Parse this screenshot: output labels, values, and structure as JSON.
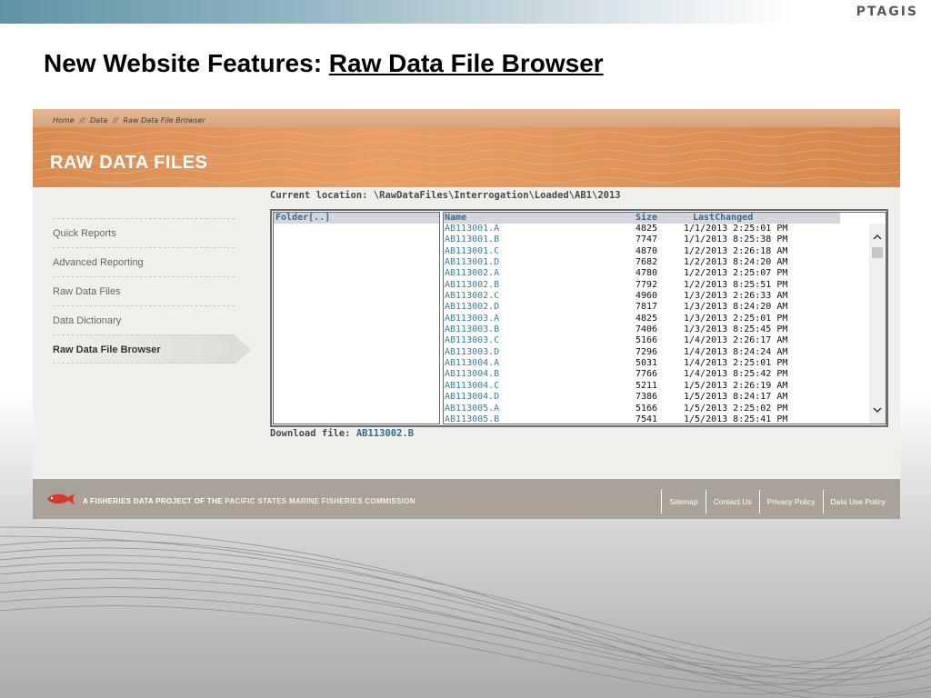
{
  "slide": {
    "logo": "PTAGIS",
    "title_prefix": "New Website Features: ",
    "title_link": "Raw Data File Browser"
  },
  "breadcrumb": [
    "Home",
    "Data",
    "Raw Data File Browser"
  ],
  "breadcrumb_separator": "//",
  "banner": {
    "title": "RAW DATA FILES"
  },
  "nav": [
    {
      "label": "Quick Reports"
    },
    {
      "label": "Advanced Reporting"
    },
    {
      "label": "Raw Data Files"
    },
    {
      "label": "Data Dictionary"
    },
    {
      "label": "Raw Data File Browser",
      "active": true
    }
  ],
  "browser": {
    "location_label": "Current location:",
    "location_path": "\\RawDataFiles\\Interrogation\\Loaded\\AB1\\2013",
    "folder_header": "Folder[..]",
    "columns": {
      "name": "Name",
      "size": "Size",
      "changed": "LastChanged"
    },
    "files": [
      {
        "name": "AB113001.A",
        "size": "4825",
        "changed": "1/1/2013 2:25:01 PM"
      },
      {
        "name": "AB113001.B",
        "size": "7747",
        "changed": "1/1/2013 8:25:38 PM"
      },
      {
        "name": "AB113001.C",
        "size": "4870",
        "changed": "1/2/2013 2:26:18 AM"
      },
      {
        "name": "AB113001.D",
        "size": "7682",
        "changed": "1/2/2013 8:24:20 AM"
      },
      {
        "name": "AB113002.A",
        "size": "4780",
        "changed": "1/2/2013 2:25:07 PM"
      },
      {
        "name": "AB113002.B",
        "size": "7792",
        "changed": "1/2/2013 8:25:51 PM"
      },
      {
        "name": "AB113002.C",
        "size": "4960",
        "changed": "1/3/2013 2:26:33 AM"
      },
      {
        "name": "AB113002.D",
        "size": "7817",
        "changed": "1/3/2013 8:24:20 AM"
      },
      {
        "name": "AB113003.A",
        "size": "4825",
        "changed": "1/3/2013 2:25:01 PM"
      },
      {
        "name": "AB113003.B",
        "size": "7406",
        "changed": "1/3/2013 8:25:45 PM"
      },
      {
        "name": "AB113003.C",
        "size": "5166",
        "changed": "1/4/2013 2:26:17 AM"
      },
      {
        "name": "AB113003.D",
        "size": "7296",
        "changed": "1/4/2013 8:24:24 AM"
      },
      {
        "name": "AB113004.A",
        "size": "5031",
        "changed": "1/4/2013 2:25:01 PM"
      },
      {
        "name": "AB113004.B",
        "size": "7766",
        "changed": "1/4/2013 8:25:42 PM"
      },
      {
        "name": "AB113004.C",
        "size": "5211",
        "changed": "1/5/2013 2:26:19 AM"
      },
      {
        "name": "AB113004.D",
        "size": "7386",
        "changed": "1/5/2013 8:24:17 AM"
      },
      {
        "name": "AB113005.A",
        "size": "5166",
        "changed": "1/5/2013 2:25:02 PM"
      },
      {
        "name": "AB113005.B",
        "size": "7541",
        "changed": "1/5/2013 8:25:41 PM"
      }
    ],
    "download_label": "Download file:",
    "download_file": "AB113002.B"
  },
  "footer": {
    "project_text": "A FISHERIES DATA PROJECT OF THE",
    "org_text": "PACIFIC STATES MARINE FISHERIES COMMISSION",
    "links": [
      "Sitemap",
      "Contact Us",
      "Privacy Policy",
      "Data Use Policy"
    ]
  },
  "icons": {
    "scroll_up": "chevron-up-icon",
    "scroll_down": "chevron-down-icon",
    "footer_logo": "fish-icon"
  },
  "colors": {
    "banner": "#e09458",
    "link": "#3b7e99",
    "footer": "#a8a29a"
  }
}
